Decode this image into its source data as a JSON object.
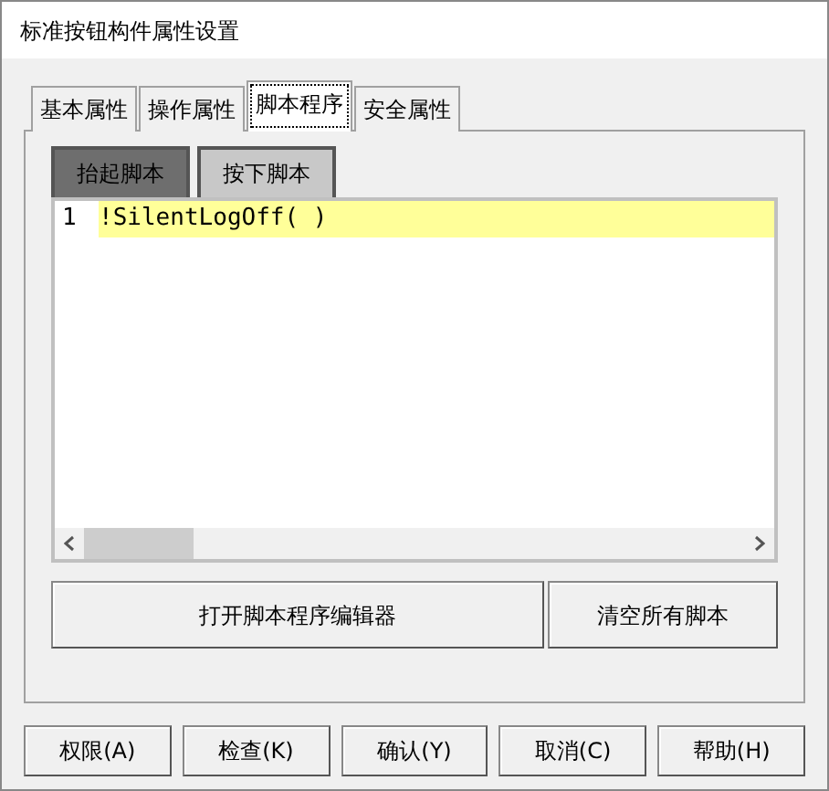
{
  "window": {
    "title": "标准按钮构件属性设置"
  },
  "tabs": [
    {
      "label": "基本属性",
      "selected": false
    },
    {
      "label": "操作属性",
      "selected": false
    },
    {
      "label": "脚本程序",
      "selected": true
    },
    {
      "label": "安全属性",
      "selected": false
    }
  ],
  "script_tabs": [
    {
      "label": "抬起脚本",
      "selected": true
    },
    {
      "label": "按下脚本",
      "selected": false
    }
  ],
  "editor": {
    "lines": [
      {
        "number": "1",
        "text": "!SilentLogOff( )",
        "highlighted": true
      }
    ]
  },
  "actions": [
    "打开脚本程序编辑器",
    "清空所有脚本"
  ],
  "buttons": [
    "权限(A)",
    "检查(K)",
    "确认(Y)",
    "取消(C)",
    "帮助(H)"
  ]
}
